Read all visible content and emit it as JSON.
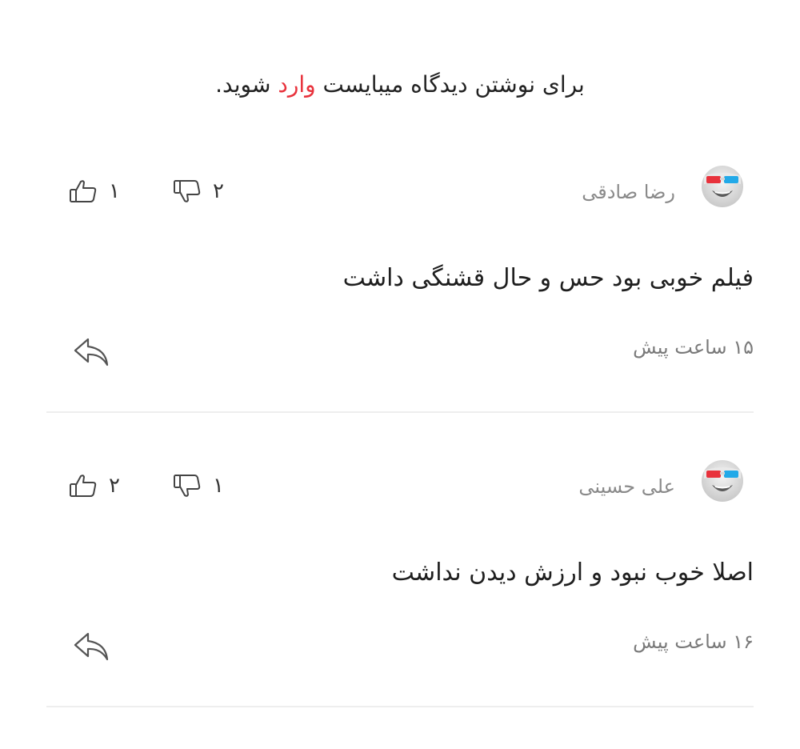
{
  "login_prompt": {
    "before": "برای نوشتن دیدگاه میبایست ",
    "link": "وارد",
    "after": " شوید."
  },
  "colors": {
    "accent": "#e8323c",
    "muted_text": "#8a8a8a",
    "divider": "#eeeeee"
  },
  "comments": [
    {
      "author": "رضا صادقی",
      "avatar_icon": "3d-glasses-avatar-icon",
      "likes": "۱",
      "dislikes": "۲",
      "text": "فیلم خوبی بود حس و حال قشنگی داشت",
      "time": "۱۵ ساعت پیش"
    },
    {
      "author": "علی حسینی",
      "avatar_icon": "3d-glasses-avatar-icon",
      "likes": "۲",
      "dislikes": "۱",
      "text": "اصلا خوب نبود و ارزش دیدن نداشت",
      "time": "۱۶ ساعت پیش"
    }
  ]
}
